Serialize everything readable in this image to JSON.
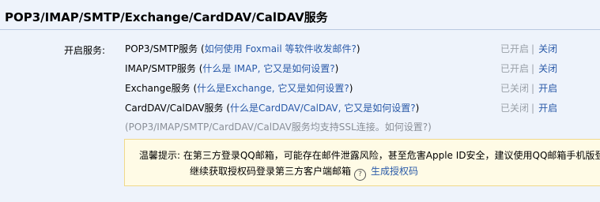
{
  "page_title": "POP3/IMAP/SMTP/Exchange/CardDAV/CalDAV服务",
  "label": "开启服务:",
  "services": [
    {
      "name": "POP3/SMTP服务",
      "open_paren": " (",
      "help_link": "如何使用 Foxmail 等软件收发邮件?",
      "close_paren": ")",
      "status": "已开启",
      "separator": "|",
      "action": "关闭"
    },
    {
      "name": "IMAP/SMTP服务",
      "open_paren": " (",
      "help_link": "什么是 IMAP, 它又是如何设置?",
      "close_paren": ")",
      "status": "已开启",
      "separator": "|",
      "action": "关闭"
    },
    {
      "name": "Exchange服务",
      "open_paren": " (",
      "help_link": "什么是Exchange, 它又是如何设置?",
      "close_paren": ")",
      "status": "已关闭",
      "separator": "|",
      "action": "开启"
    },
    {
      "name": "CardDAV/CalDAV服务",
      "open_paren": " (",
      "help_link": "什么是CardDAV/CalDAV, 它又是如何设置?",
      "close_paren": ")",
      "status": "已关闭",
      "separator": "|",
      "action": "开启"
    }
  ],
  "ssl_note": {
    "prefix": "(POP3/IMAP/SMTP/CardDAV/CalDAV服务均支持SSL连接。",
    "link": "如何设置?",
    "suffix": ")"
  },
  "tip": {
    "line1": "温馨提示: 在第三方登录QQ邮箱，可能存在邮件泄露风险，甚至危害Apple ID安全，建议使用QQ邮箱手机版登录",
    "line2": "继续获取授权码登录第三方客户端邮箱",
    "help_icon": "?",
    "generate_link": "生成授权码"
  }
}
